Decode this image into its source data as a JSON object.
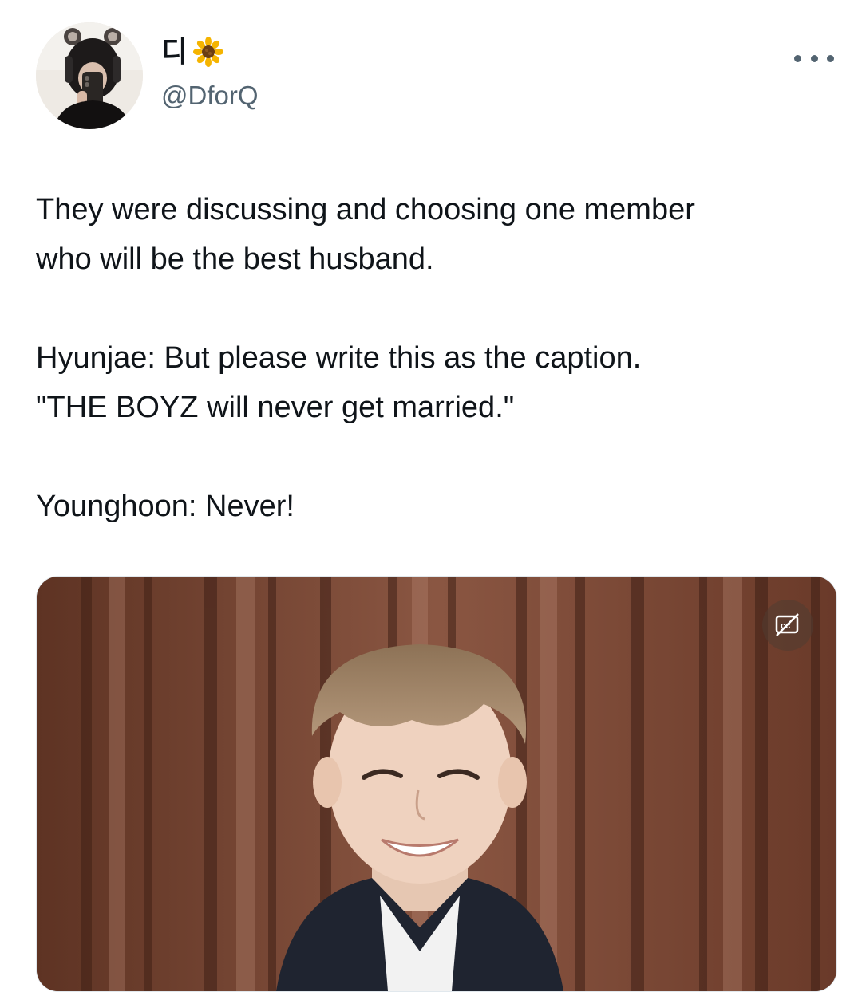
{
  "author": {
    "display_name": "디",
    "display_emoji": "sunflower-icon",
    "handle": "@DforQ",
    "avatar": "user-avatar"
  },
  "tweet": {
    "paragraph_1_line_1": "They were discussing and choosing one member",
    "paragraph_1_line_2": "who will be the best husband.",
    "paragraph_2_line_1": "Hyunjae: But please write this as the caption.",
    "paragraph_2_line_2": "\"THE BOYZ will never get married.\"",
    "paragraph_3_line_1": "Younghoon: Never!"
  },
  "media": {
    "type": "video",
    "captions_icon": "closed-captions-off-icon"
  },
  "colors": {
    "text_primary": "#0f1419",
    "text_secondary": "#536471",
    "background": "#ffffff"
  }
}
